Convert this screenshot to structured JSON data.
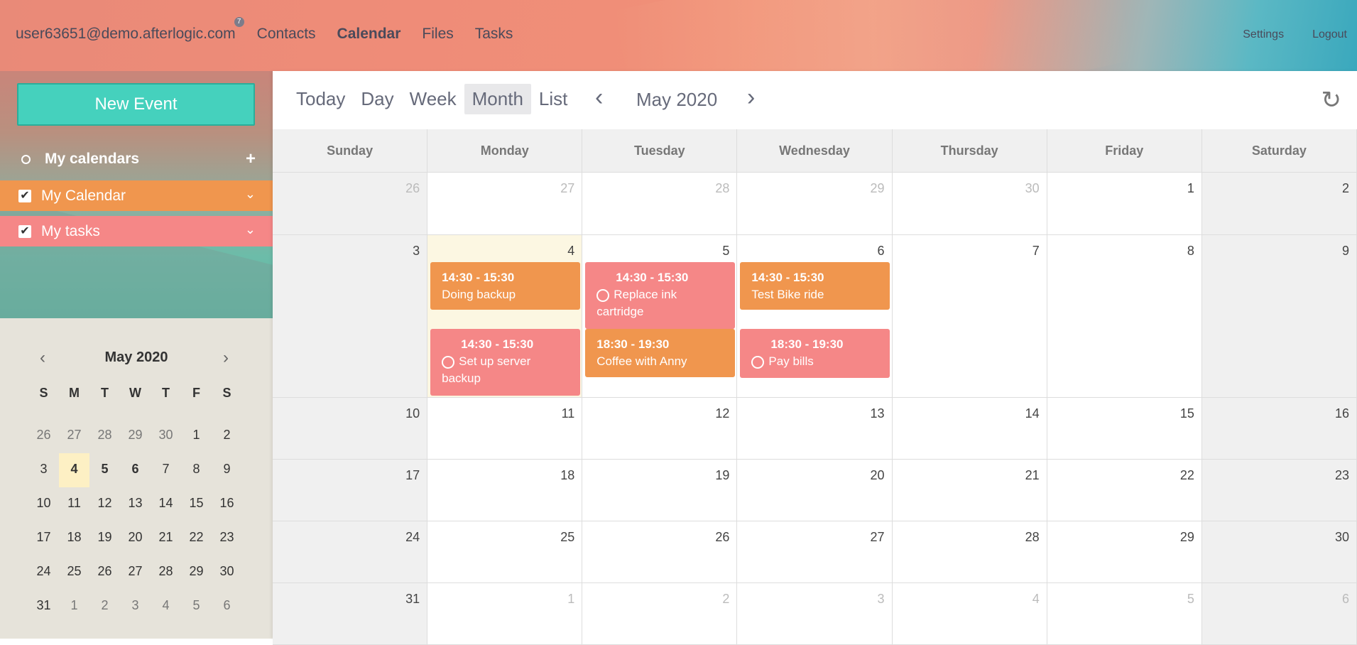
{
  "header": {
    "email": "user63651@demo.afterlogic.com",
    "badge": "7",
    "nav": [
      "Contacts",
      "Calendar",
      "Files",
      "Tasks"
    ],
    "settings": "Settings",
    "logout": "Logout"
  },
  "sidebar": {
    "new_event": "New Event",
    "my_calendars": "My calendars",
    "add": "+",
    "calendars": [
      {
        "label": "My Calendar",
        "color": "#f0964e"
      },
      {
        "label": "My tasks",
        "color": "#f58787"
      }
    ],
    "mini": {
      "title": "May 2020",
      "prev": "‹",
      "next": "›",
      "weekdays": [
        "S",
        "M",
        "T",
        "W",
        "T",
        "F",
        "S"
      ],
      "weeks": [
        [
          "26",
          "27",
          "28",
          "29",
          "30",
          "1",
          "2"
        ],
        [
          "3",
          "4",
          "5",
          "6",
          "7",
          "8",
          "9"
        ],
        [
          "10",
          "11",
          "12",
          "13",
          "14",
          "15",
          "16"
        ],
        [
          "17",
          "18",
          "19",
          "20",
          "21",
          "22",
          "23"
        ],
        [
          "24",
          "25",
          "26",
          "27",
          "28",
          "29",
          "30"
        ],
        [
          "31",
          "1",
          "2",
          "3",
          "4",
          "5",
          "6"
        ]
      ]
    }
  },
  "toolbar": {
    "views": [
      "Today",
      "Day",
      "Week",
      "Month",
      "List"
    ],
    "active_view": "Month",
    "prev": "‹",
    "next": "›",
    "month": "May 2020",
    "refresh": "↻"
  },
  "calendar": {
    "days": [
      "Sunday",
      "Monday",
      "Tuesday",
      "Wednesday",
      "Thursday",
      "Friday",
      "Saturday"
    ],
    "weeks": [
      [
        "26",
        "27",
        "28",
        "29",
        "30",
        "1",
        "2"
      ],
      [
        "3",
        "4",
        "5",
        "6",
        "7",
        "8",
        "9"
      ],
      [
        "10",
        "11",
        "12",
        "13",
        "14",
        "15",
        "16"
      ],
      [
        "17",
        "18",
        "19",
        "20",
        "21",
        "22",
        "23"
      ],
      [
        "24",
        "25",
        "26",
        "27",
        "28",
        "29",
        "30"
      ],
      [
        "31",
        "1",
        "2",
        "3",
        "4",
        "5",
        "6"
      ]
    ],
    "events": [
      {
        "time": "14:30 - 15:30",
        "title": "Doing backup",
        "color": "orange"
      },
      {
        "time": "14:30 - 15:30",
        "title": "Set up server backup",
        "color": "pink",
        "task": true
      },
      {
        "time": "14:30 - 15:30",
        "title": "Replace ink cartridge",
        "color": "pink",
        "task": true
      },
      {
        "time": "18:30 - 19:30",
        "title": "Coffee with Anny",
        "color": "orange"
      },
      {
        "time": "14:30 - 15:30",
        "title": "Test Bike ride",
        "color": "orange"
      },
      {
        "time": "18:30 - 19:30",
        "title": "Pay bills",
        "color": "pink",
        "task": true
      }
    ]
  }
}
